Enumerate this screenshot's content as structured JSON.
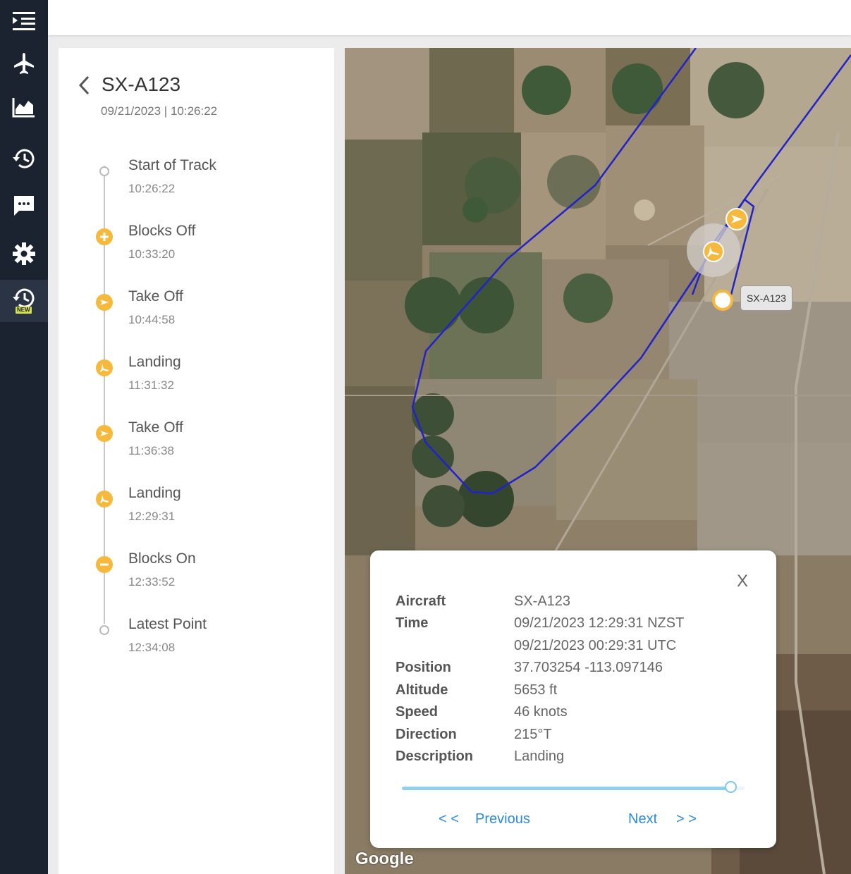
{
  "nav": {
    "items": [
      {
        "name": "menu-toggle-icon"
      },
      {
        "name": "airplane-icon"
      },
      {
        "name": "chart-icon"
      },
      {
        "name": "history-icon"
      },
      {
        "name": "chat-icon"
      },
      {
        "name": "gear-icon"
      },
      {
        "name": "history-new-icon",
        "badge": "NEW"
      }
    ]
  },
  "track": {
    "title": "SX-A123",
    "subtitle": "09/21/2023 | 10:26:22",
    "events": [
      {
        "label": "Start of Track",
        "time": "10:26:22",
        "icon": "hollow-circle"
      },
      {
        "label": "Blocks Off",
        "time": "10:33:20",
        "icon": "plus-icon"
      },
      {
        "label": "Take Off",
        "time": "10:44:58",
        "icon": "takeoff-icon"
      },
      {
        "label": "Landing",
        "time": "11:31:32",
        "icon": "landing-icon"
      },
      {
        "label": "Take Off",
        "time": "11:36:38",
        "icon": "takeoff-icon"
      },
      {
        "label": "Landing",
        "time": "12:29:31",
        "icon": "landing-icon"
      },
      {
        "label": "Blocks On",
        "time": "12:33:52",
        "icon": "minus-icon"
      },
      {
        "label": "Latest Point",
        "time": "12:34:08",
        "icon": "hollow-circle"
      }
    ]
  },
  "map": {
    "aircraft_label": "SX-A123",
    "attribution": "Google",
    "track_color": "#2222cc",
    "marker_color": "#f6b93b"
  },
  "info": {
    "close": "X",
    "rows": [
      {
        "key": "Aircraft",
        "value": "SX-A123"
      },
      {
        "key": "Time",
        "value": "09/21/2023 12:29:31 NZST"
      },
      {
        "key": "",
        "value": "09/21/2023 00:29:31 UTC"
      },
      {
        "key": "Position",
        "value": "37.703254 -113.097146"
      },
      {
        "key": "Altitude",
        "value": "5653 ft"
      },
      {
        "key": "Speed",
        "value": "46 knots"
      },
      {
        "key": "Direction",
        "value": "215°T"
      },
      {
        "key": "Description",
        "value": "Landing"
      }
    ],
    "slider_fraction": 0.96,
    "prev_arrows": "< <",
    "prev_label": "Previous",
    "next_label": "Next",
    "next_arrows": "> >"
  }
}
